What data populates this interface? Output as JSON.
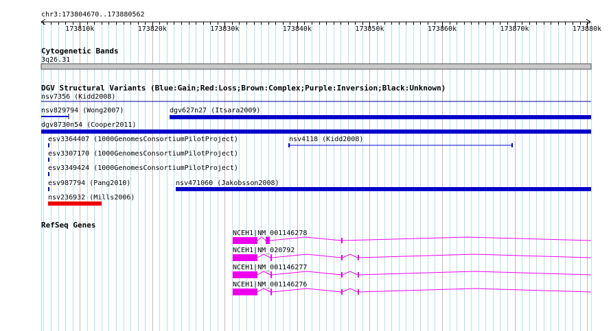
{
  "location": "chr3:173804670..173880562",
  "ruler": {
    "ticks": [
      "173810k",
      "173820k",
      "173830k",
      "173840k",
      "173850k",
      "173860k",
      "173870k",
      "173880k"
    ]
  },
  "tracks": {
    "cytobands": {
      "title": "Cytogenetic Bands",
      "band": "3q26.31"
    },
    "dgv": {
      "title": "DGV Structural Variants (Blue:Gain;Red:Loss;Brown:Complex;Purple:Inversion;Black:Unknown)",
      "features": [
        {
          "label": "nsv7356 (Kidd2008)",
          "color": "#000099",
          "style": "line"
        },
        {
          "label": "nsv829794 (Wong2007)",
          "color": "#0000cc",
          "style": "thin"
        },
        {
          "label": "dgv627n27 (Itsara2009)",
          "color": "#0000cc",
          "style": "thick"
        },
        {
          "label": "dgv8730n54 (Cooper2011)",
          "color": "#0000cc",
          "style": "thick"
        },
        {
          "label": "esv3364407 (1000GenomesConsortiumPilotProject)",
          "color": "#0000cc",
          "style": "tiny"
        },
        {
          "label": "nsv4118 (Kidd2008)",
          "color": "#0000cc",
          "style": "interval"
        },
        {
          "label": "esv3307170 (1000GenomesConsortiumPilotProject)",
          "color": "#0000cc",
          "style": "tiny"
        },
        {
          "label": "esv3349424 (1000GenomesConsortiumPilotProject)",
          "color": "#0000cc",
          "style": "tiny"
        },
        {
          "label": "esv987794 (Pang2010)",
          "color": "#0000cc",
          "style": "tiny"
        },
        {
          "label": "nsv471060 (Jakobsson2008)",
          "color": "#0000cc",
          "style": "thick"
        },
        {
          "label": "nsv236932 (Mills2006)",
          "color": "#ee0000",
          "style": "thick"
        }
      ]
    },
    "refseq": {
      "title": "RefSeq Genes",
      "color": "#ee00ee",
      "transcripts": [
        {
          "label": "NCEH1|NM_001146278"
        },
        {
          "label": "NCEH1|NM_020792"
        },
        {
          "label": "NCEH1|NM_001146277"
        },
        {
          "label": "NCEH1|NM_001146276"
        }
      ]
    }
  }
}
